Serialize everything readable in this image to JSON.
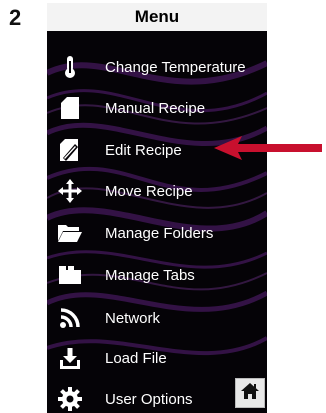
{
  "step_number": "2",
  "menu": {
    "title": "Menu",
    "items": [
      {
        "label": "Change Temperature",
        "icon": "thermometer-icon"
      },
      {
        "label": "Manual Recipe",
        "icon": "document-icon"
      },
      {
        "label": "Edit Recipe",
        "icon": "edit-document-icon"
      },
      {
        "label": "Move Recipe",
        "icon": "move-arrows-icon"
      },
      {
        "label": "Manage Folders",
        "icon": "folder-icon"
      },
      {
        "label": "Manage Tabs",
        "icon": "tabs-icon"
      },
      {
        "label": "Network",
        "icon": "network-rss-icon"
      },
      {
        "label": "Load File",
        "icon": "download-tray-icon"
      },
      {
        "label": "User Options",
        "icon": "gear-icon"
      }
    ]
  },
  "home_button": {
    "icon": "home-icon"
  },
  "callout_arrow": {
    "color": "#c8102e",
    "target": "Edit Recipe"
  },
  "colors": {
    "screen_bg": "#050307",
    "header_bg": "#f3f3f3",
    "wave": "#6a2a8a",
    "text": "#ffffff"
  }
}
